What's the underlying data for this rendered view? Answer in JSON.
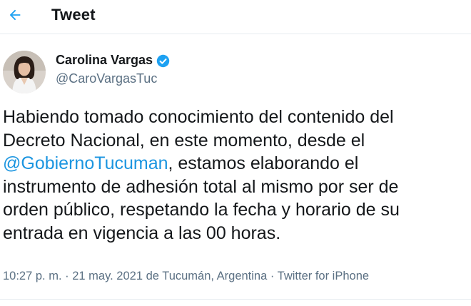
{
  "header": {
    "back_icon": "arrow-left-icon",
    "title": "Tweet"
  },
  "author": {
    "name": "Carolina Vargas",
    "handle": "@CaroVargasTuc",
    "verified_icon": "verified-badge-icon"
  },
  "tweet": {
    "line1": "Habiendo tomado conocimiento del contenido del",
    "line2": "Decreto Nacional, en este momento, desde el",
    "mention": "@GobiernoTucuman",
    "line3_rest": ", estamos  elaborando el",
    "line4": "instrumento de adhesión total al mismo por ser de",
    "line5": "orden público, respetando la fecha y horario de su",
    "line6": "entrada en vigencia a las 00 horas."
  },
  "meta": {
    "time": "10:27 p. m.",
    "sep1": " · ",
    "date": "21 may. 2021",
    "location": " de Tucumán, Argentina",
    "sep2": " · ",
    "client": "Twitter for iPhone"
  },
  "colors": {
    "accent": "#1da1f2",
    "mention": "#1b95e0",
    "text": "#14171a",
    "secondary": "#5b7083"
  }
}
